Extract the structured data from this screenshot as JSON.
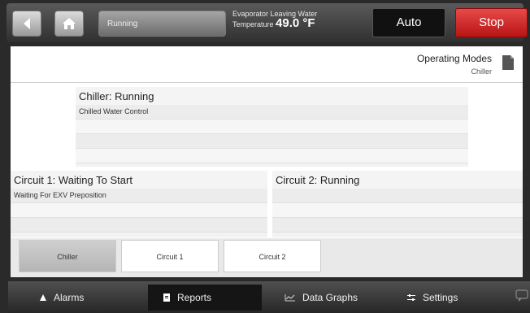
{
  "topbar": {
    "status": "Running",
    "evap_label_line1": "Evaporator Leaving Water",
    "evap_label_line2": "Temperature",
    "evap_value": "49.0 °F",
    "auto_label": "Auto",
    "stop_label": "Stop",
    "icons": {
      "back": "back-arrow-icon",
      "home": "home-icon"
    }
  },
  "header": {
    "title": "Operating Modes",
    "subtitle": "Chiller",
    "icon": "document-icon"
  },
  "chiller": {
    "title": "Chiller:  Running",
    "line1": "Chilled Water Control"
  },
  "circuit1": {
    "title": "Circuit 1:  Waiting To Start",
    "line1": "Waiting For EXV Preposition"
  },
  "circuit2": {
    "title": "Circuit 2:  Running",
    "line1": ""
  },
  "tabs": [
    {
      "label": "Chiller"
    },
    {
      "label": "Circuit 1"
    },
    {
      "label": "Circuit 2"
    }
  ],
  "bottom_nav": [
    {
      "label": "Alarms",
      "icon": "bell-icon"
    },
    {
      "label": "Reports",
      "icon": "report-icon"
    },
    {
      "label": "Data Graphs",
      "icon": "graph-icon"
    },
    {
      "label": "Settings",
      "icon": "settings-icon"
    }
  ],
  "colors": {
    "stop": "#d32020",
    "auto": "#111111"
  }
}
